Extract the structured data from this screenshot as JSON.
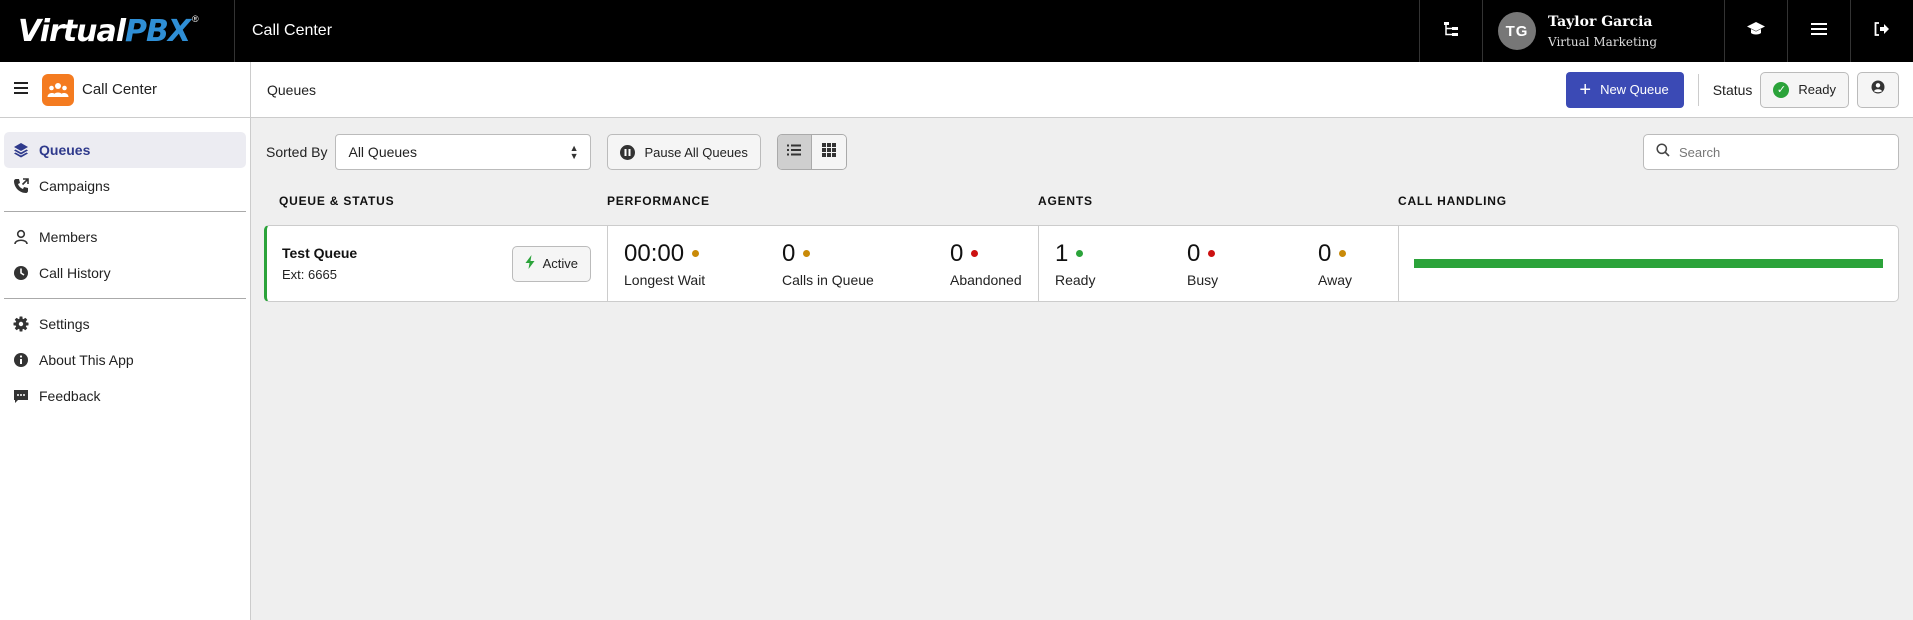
{
  "topbar": {
    "logo_part1": "Virtual",
    "logo_part2": "PBX",
    "app_title": "Call Center",
    "user": {
      "initials": "TG",
      "name": "Taylor Garcia",
      "org": "Virtual Marketing"
    },
    "icons": [
      "org-chart-icon",
      "graduation-cap-icon",
      "menu-icon",
      "logout-icon"
    ]
  },
  "sidebar": {
    "header_label": "Call Center",
    "items": [
      {
        "label": "Queues",
        "icon": "layers-icon",
        "active": true
      },
      {
        "label": "Campaigns",
        "icon": "phone-outgoing-icon"
      },
      {
        "label": "Members",
        "icon": "user-icon"
      },
      {
        "label": "Call History",
        "icon": "clock-icon"
      },
      {
        "label": "Settings",
        "icon": "gear-icon"
      },
      {
        "label": "About This App",
        "icon": "info-icon"
      },
      {
        "label": "Feedback",
        "icon": "comment-icon"
      }
    ]
  },
  "header": {
    "title": "Queues",
    "new_queue_label": "New Queue",
    "status_label": "Status",
    "status_value": "Ready"
  },
  "toolbar": {
    "sorted_by_label": "Sorted By",
    "sort_value": "All Queues",
    "pause_all_label": "Pause All Queues",
    "search_placeholder": "Search"
  },
  "columns": {
    "queue_status": "QUEUE & STATUS",
    "performance": "PERFORMANCE",
    "agents": "AGENTS",
    "call_handling": "CALL HANDLING"
  },
  "queues": [
    {
      "name": "Test Queue",
      "ext": "Ext: 6665",
      "state_label": "Active",
      "performance": [
        {
          "value": "00:00",
          "label": "Longest Wait",
          "dot": "amber"
        },
        {
          "value": "0",
          "label": "Calls in Queue",
          "dot": "amber"
        },
        {
          "value": "0",
          "label": "Abandoned",
          "dot": "red"
        }
      ],
      "agents": [
        {
          "value": "1",
          "label": "Ready",
          "dot": "green"
        },
        {
          "value": "0",
          "label": "Busy",
          "dot": "red"
        },
        {
          "value": "0",
          "label": "Away",
          "dot": "amber"
        }
      ],
      "call_handling_fraction": 1.0
    }
  ],
  "colors": {
    "topbar_bg": "#000000",
    "brand_blue": "#2f8fd6",
    "primary_button": "#3b4ab5",
    "active_green": "#2ba33a",
    "app_icon_orange": "#f47b20"
  }
}
